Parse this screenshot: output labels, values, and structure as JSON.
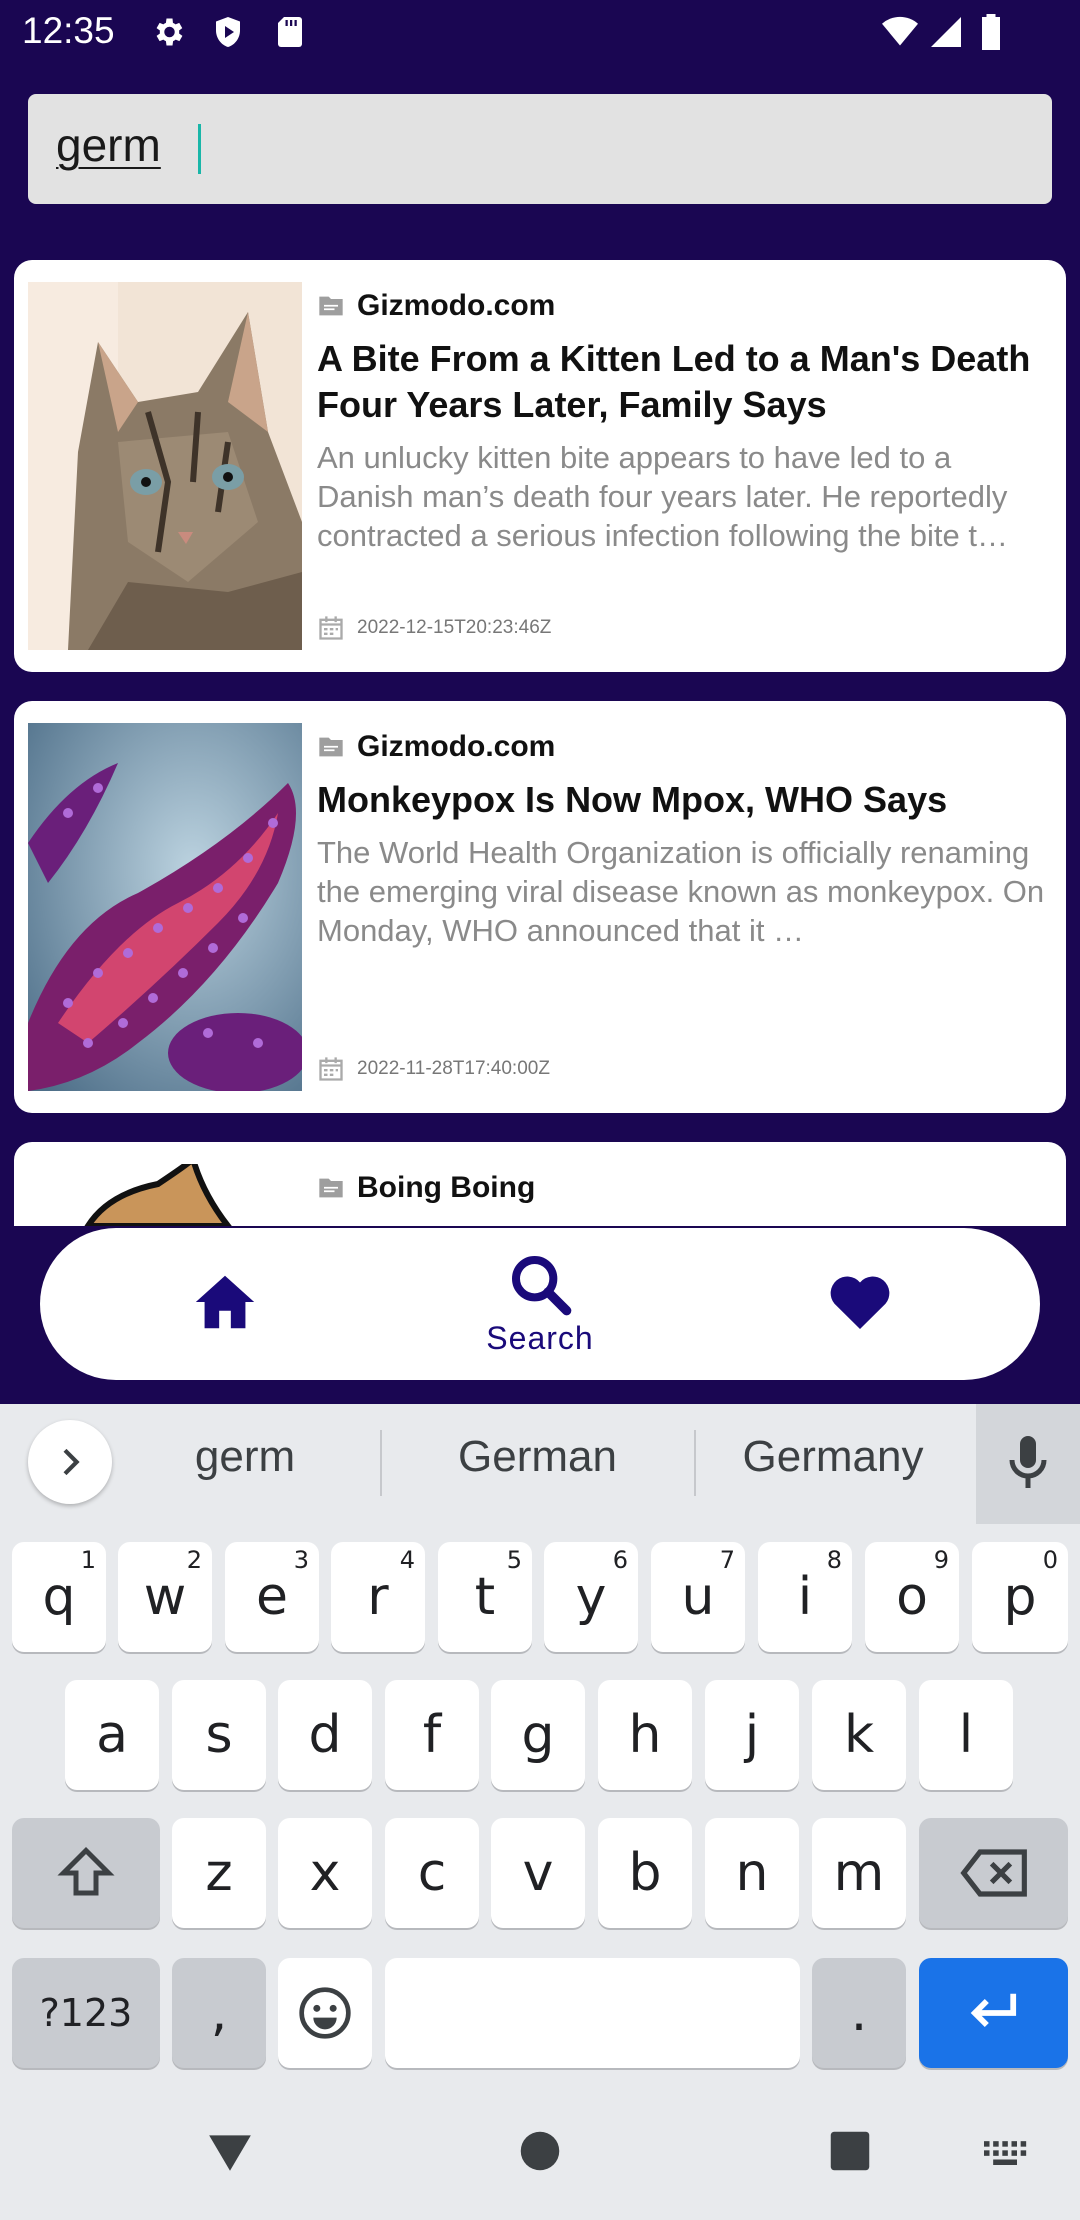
{
  "status_bar": {
    "time": "12:35",
    "left_icons": [
      "settings-icon",
      "shield-icon",
      "sd-card-icon"
    ],
    "right_icons": [
      "wifi-icon",
      "signal-icon",
      "battery-icon"
    ]
  },
  "search": {
    "value": "germ"
  },
  "articles": [
    {
      "source": "Gizmodo.com",
      "title": "A Bite From a Kitten Led to a Man's Death Four Years Later, Family Says",
      "description": "An unlucky kitten bite appears to have led to a Danish man’s death four years later. He reportedly contracted a serious infection following the bite t…",
      "date": "2022-12-15T20:23:46Z",
      "image": "kitten-photo"
    },
    {
      "source": "Gizmodo.com",
      "title": "Monkeypox Is Now Mpox, WHO Says",
      "description": "The World Health Organization is officially renaming the emerging viral disease known as monkeypox. On Monday, WHO announced that it …",
      "date": "2022-11-28T17:40:00Z",
      "image": "virus-illustration"
    },
    {
      "source": "Boing Boing",
      "title": "",
      "description": "",
      "date": "",
      "image": "cartoon-illustration"
    }
  ],
  "bottom_nav": {
    "items": [
      {
        "icon": "home-icon",
        "label": ""
      },
      {
        "icon": "search-icon",
        "label": "Search"
      },
      {
        "icon": "heart-icon",
        "label": ""
      }
    ],
    "active_color": "#1a0a7a"
  },
  "keyboard": {
    "suggestions": [
      "germ",
      "German",
      "Germany"
    ],
    "row1": [
      {
        "k": "q",
        "h": "1"
      },
      {
        "k": "w",
        "h": "2"
      },
      {
        "k": "e",
        "h": "3"
      },
      {
        "k": "r",
        "h": "4"
      },
      {
        "k": "t",
        "h": "5"
      },
      {
        "k": "y",
        "h": "6"
      },
      {
        "k": "u",
        "h": "7"
      },
      {
        "k": "i",
        "h": "8"
      },
      {
        "k": "o",
        "h": "9"
      },
      {
        "k": "p",
        "h": "0"
      }
    ],
    "row2": [
      "a",
      "s",
      "d",
      "f",
      "g",
      "h",
      "j",
      "k",
      "l"
    ],
    "row3": [
      "z",
      "x",
      "c",
      "v",
      "b",
      "n",
      "m"
    ],
    "symbols_label": "?123",
    "comma_label": ",",
    "period_label": ".",
    "enter_color": "#1a73e8"
  },
  "theme": {
    "background": "#1a0652",
    "card": "#ffffff"
  }
}
